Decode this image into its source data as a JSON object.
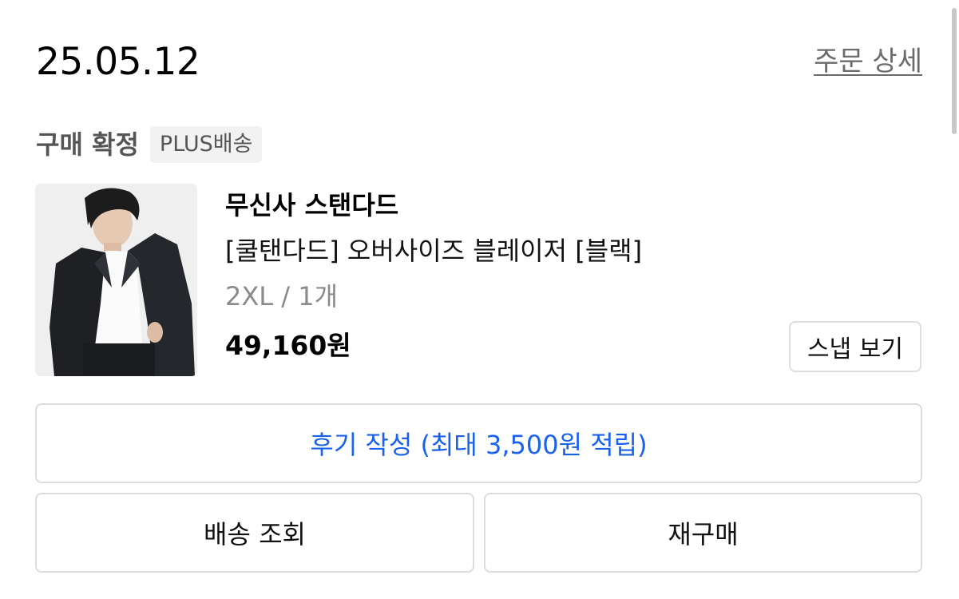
{
  "order": {
    "date": "25.05.12",
    "detail_link": "주문 상세",
    "status": "구매 확정",
    "delivery_badge": "PLUS배송"
  },
  "product": {
    "brand": "무신사 스탠다드",
    "name": "[쿨탠다드] 오버사이즈 블레이저 [블랙]",
    "option": "2XL / 1개",
    "price": "49,160원",
    "image_alt": "model-wearing-black-blazer"
  },
  "buttons": {
    "snap": "스냅 보기",
    "review": "후기 작성 (최대 3,500원 적립)",
    "tracking": "배송 조회",
    "rebuy": "재구매"
  },
  "colors": {
    "accent": "#1a61f0",
    "muted_text": "#8a8a8a",
    "border": "#dcdcdc",
    "badge_bg": "#f2f2f2"
  }
}
